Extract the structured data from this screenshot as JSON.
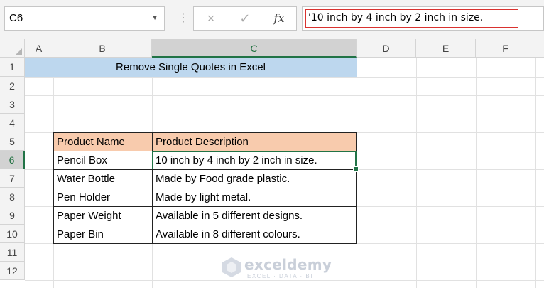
{
  "formula_bar": {
    "name_box": "C6",
    "name_box_dropdown_icon": "chevron-down-icon",
    "separator_icon": "vertical-dots-icon",
    "cancel_icon": "×",
    "enter_icon": "✓",
    "fx_label": "fx",
    "value": "'10 inch by 4 inch by 2 inch in size.",
    "value_highlight_color": "#d9322f"
  },
  "sheet": {
    "columns": [
      "A",
      "B",
      "C",
      "D",
      "E",
      "F"
    ],
    "selected_column": "C",
    "rows": [
      "1",
      "2",
      "3",
      "4",
      "5",
      "6",
      "7",
      "8",
      "9",
      "10",
      "11",
      "12"
    ],
    "selected_row": "6",
    "title": "Remove Single Quotes in Excel",
    "title_fill": "#bdd7ee",
    "table": {
      "header_fill": "#f8cbad",
      "headers": [
        "Product Name",
        "Product Description"
      ],
      "rows": [
        [
          "Pencil Box",
          "10 inch by 4 inch by 2 inch in size."
        ],
        [
          "Water Bottle",
          "Made by Food grade plastic."
        ],
        [
          "Pen Holder",
          "Made by light metal."
        ],
        [
          "Paper Weight",
          "Available in 5 different designs."
        ],
        [
          "Paper Bin",
          "Available in 8 different colours."
        ]
      ]
    },
    "active_cell": "C6",
    "accent_color": "#217346"
  },
  "watermark": {
    "brand": "exceldemy",
    "tagline": "EXCEL · DATA · BI"
  }
}
